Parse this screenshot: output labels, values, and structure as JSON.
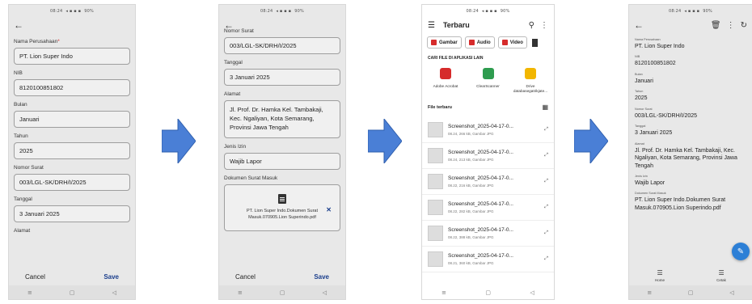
{
  "status_text": "08:24",
  "status_right": "90%",
  "colors": {
    "arrow": "#4a7fd6",
    "accent": "#1a3e8c",
    "fab": "#2c7fd6"
  },
  "form1": {
    "fields": [
      {
        "label": "Nama Perusahaan",
        "value": "PT. Lion Super Indo"
      },
      {
        "label": "NIB",
        "value": "8120100851802"
      },
      {
        "label": "Bulan",
        "value": "Januari"
      },
      {
        "label": "Tahun",
        "value": "2025"
      },
      {
        "label": "Nomor Surat",
        "value": "003/LGL-SK/DRH/I/2025"
      },
      {
        "label": "Tanggal",
        "value": "3 Januari 2025"
      },
      {
        "label": "Alamat"
      }
    ],
    "cancel": "Cancel",
    "save": "Save"
  },
  "form2": {
    "top_label": "Nomor Surat",
    "nomor": "003/LGL-SK/DRH/I/2025",
    "tanggal_label": "Tanggal",
    "tanggal": "3 Januari 2025",
    "alamat_label": "Alamat",
    "alamat": "Jl. Prof. Dr. Hamka Kel. Tambakaji, Kec. Ngaliyan, Kota Semarang, Provinsi Jawa Tengah",
    "jenis_label": "Jenis Izin",
    "jenis": "Wajib Lapor",
    "dok_label": "Dokumen Surat Masuk",
    "file_name": "PT. Lion Super Indo.Dokumen Surat Masuk.070905.Lion Superindo.pdf",
    "cancel": "Cancel",
    "save": "Save"
  },
  "picker": {
    "title": "Terbaru",
    "chips": [
      "Gambar",
      "Audio",
      "Video"
    ],
    "apps_section": "CARI FILE DI APLIKASI LAIN",
    "apps": [
      {
        "name": "Adobe Acrobat",
        "color": "#d62b2b"
      },
      {
        "name": "ClearScanner",
        "color": "#2e9c4f"
      },
      {
        "name": "Drive",
        "sub": "databasegatrikjate...",
        "color": "#f2b600"
      }
    ],
    "recent_title": "File terbaru",
    "files": [
      {
        "name": "Screenshot_2025-04-17-0...",
        "meta": "08.24, 266 kB, Gambar JPG"
      },
      {
        "name": "Screenshot_2025-04-17-0...",
        "meta": "08.24, 213 kB, Gambar JPG"
      },
      {
        "name": "Screenshot_2025-04-17-0...",
        "meta": "08.22, 216 kB, Gambar JPG"
      },
      {
        "name": "Screenshot_2025-04-17-0...",
        "meta": "08.22, 282 kB, Gambar JPG"
      },
      {
        "name": "Screenshot_2025-04-17-0...",
        "meta": "08.22, 388 kB, Gambar JPG"
      },
      {
        "name": "Screenshot_2025-04-17-0...",
        "meta": "08.21, 360 kB, Gambar JPG"
      }
    ]
  },
  "detail": {
    "items": [
      {
        "label": "Nama Perusahaan",
        "value": "PT. Lion Super Indo"
      },
      {
        "label": "NIB",
        "value": "8120100851802"
      },
      {
        "label": "Bulan",
        "value": "Januari"
      },
      {
        "label": "Tahun",
        "value": "2025"
      },
      {
        "label": "Nomor Surat",
        "value": "003/LGL-SK/DRH/I/2025"
      },
      {
        "label": "Tanggal",
        "value": "3 Januari 2025"
      },
      {
        "label": "Alamat",
        "value": "Jl. Prof. Dr. Hamka Kel. Tambakaji, Kec. Ngaliyan, Kota Semarang, Provinsi Jawa Tengah"
      },
      {
        "label": "Jenis Izin",
        "value": "Wajib Lapor"
      },
      {
        "label": "Dokumen Surat Masuk",
        "value": "PT. Lion Super Indo.Dokumen Surat Masuk.070905.Lion Superindo.pdf"
      }
    ],
    "tabs": [
      "Home",
      "Cetak"
    ]
  }
}
